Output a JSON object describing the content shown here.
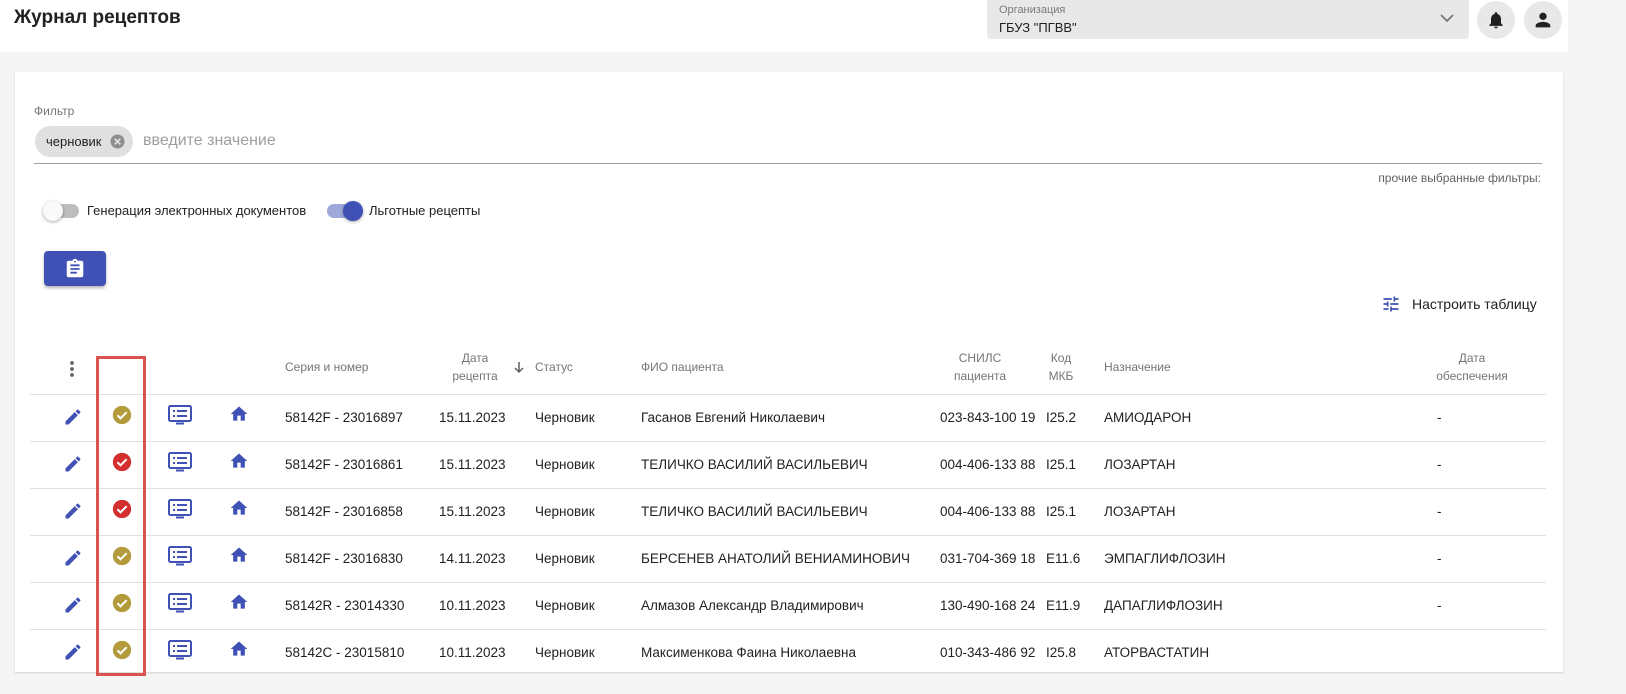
{
  "header": {
    "title": "Журнал рецептов",
    "org_label": "Организация",
    "org_value": "ГБУЗ \"ПГВВ\""
  },
  "filter": {
    "label": "Фильтр",
    "chip": "черновик",
    "placeholder": "введите значение",
    "other_filters": "прочие выбранные фильтры:"
  },
  "toggles": [
    {
      "label": "Генерация электронных документов",
      "on": false
    },
    {
      "label": "Льготные рецепты",
      "on": true
    }
  ],
  "configure_table": "Настроить таблицу",
  "columns": {
    "series": "Серия и номер",
    "date_l1": "Дата",
    "date_l2": "рецепта",
    "status": "Статус",
    "patient": "ФИО пациента",
    "snils_l1": "СНИЛС",
    "snils_l2": "пациента",
    "icd_l1": "Код",
    "icd_l2": "МКБ",
    "drug": "Назначение",
    "supply_l1": "Дата",
    "supply_l2": "обеспечения"
  },
  "colors": {
    "accent": "#3f51b5",
    "check_ok": "#b39b3b",
    "check_error": "#d32f2f",
    "highlight_box": "#d9534f"
  },
  "rows": [
    {
      "check": "ok",
      "series": "58142F - 23016897",
      "date": "15.11.2023",
      "status": "Черновик",
      "patient": "Гасанов Евгений Николаевич",
      "snils": "023-843-100 19",
      "icd": "I25.2",
      "drug": "АМИОДАРОН",
      "supply": "-"
    },
    {
      "check": "error",
      "series": "58142F - 23016861",
      "date": "15.11.2023",
      "status": "Черновик",
      "patient": "ТЕЛИЧКО ВАСИЛИЙ ВАСИЛЬЕВИЧ",
      "snils": "004-406-133 88",
      "icd": "I25.1",
      "drug": "ЛОЗАРТАН",
      "supply": "-"
    },
    {
      "check": "error",
      "series": "58142F - 23016858",
      "date": "15.11.2023",
      "status": "Черновик",
      "patient": "ТЕЛИЧКО ВАСИЛИЙ ВАСИЛЬЕВИЧ",
      "snils": "004-406-133 88",
      "icd": "I25.1",
      "drug": "ЛОЗАРТАН",
      "supply": "-"
    },
    {
      "check": "ok",
      "series": "58142F - 23016830",
      "date": "14.11.2023",
      "status": "Черновик",
      "patient": "БЕРСЕНЕВ АНАТОЛИЙ ВЕНИАМИНОВИЧ",
      "snils": "031-704-369 18",
      "icd": "E11.6",
      "drug": "ЭМПАГЛИФЛОЗИН",
      "supply": "-"
    },
    {
      "check": "ok",
      "series": "58142R - 23014330",
      "date": "10.11.2023",
      "status": "Черновик",
      "patient": "Алмазов Александр Владимирович",
      "snils": "130-490-168 24",
      "icd": "E11.9",
      "drug": "ДАПАГЛИФЛОЗИН",
      "supply": "-"
    },
    {
      "check": "ok",
      "series": "58142C - 23015810",
      "date": "10.11.2023",
      "status": "Черновик",
      "patient": "Максименкова Фаина Николаевна",
      "snils": "010-343-486 92",
      "icd": "I25.8",
      "drug": "АТОРВАСТАТИН",
      "supply": ""
    }
  ]
}
